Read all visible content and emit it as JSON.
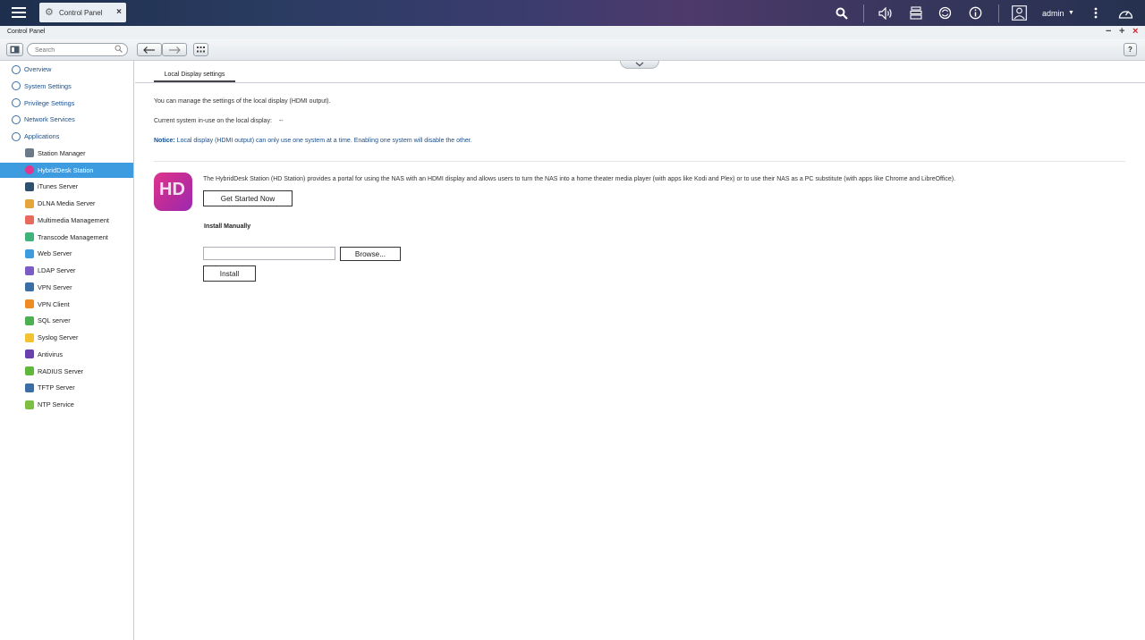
{
  "taskbar": {
    "app_tab_label": "Control Panel",
    "user_name": "admin",
    "icons": [
      "menu-icon",
      "search-icon",
      "volume-icon",
      "task-stack-icon",
      "sync-icon",
      "info-icon",
      "user-icon",
      "more-icon",
      "dashboard-icon"
    ]
  },
  "window": {
    "title": "Control Panel"
  },
  "toolbar": {
    "search_placeholder": "Search"
  },
  "sidebar": {
    "items": [
      {
        "label": "Overview",
        "level": "top",
        "icon": "grid-icon",
        "color": "#3a6ea5"
      },
      {
        "label": "System Settings",
        "level": "top",
        "icon": "gear-icon",
        "color": "#3a6ea5"
      },
      {
        "label": "Privilege Settings",
        "level": "top",
        "icon": "user-icon",
        "color": "#3a6ea5"
      },
      {
        "label": "Network Services",
        "level": "top",
        "icon": "globe-icon",
        "color": "#3a6ea5"
      },
      {
        "label": "Applications",
        "level": "top",
        "icon": "apps-icon",
        "color": "#3a6ea5"
      },
      {
        "label": "Station Manager",
        "level": "sub",
        "icon": "station-icon",
        "color": "#6b7a88"
      },
      {
        "label": "HybridDesk Station",
        "level": "sub",
        "icon": "hd-icon",
        "color": "#e0348d",
        "active": true
      },
      {
        "label": "iTunes Server",
        "level": "sub",
        "icon": "itunes-icon",
        "color": "#2f4f6f"
      },
      {
        "label": "DLNA Media Server",
        "level": "sub",
        "icon": "dlna-icon",
        "color": "#e7a43a"
      },
      {
        "label": "Multimedia Management",
        "level": "sub",
        "icon": "multimedia-icon",
        "color": "#e86a5c"
      },
      {
        "label": "Transcode Management",
        "level": "sub",
        "icon": "transcode-icon",
        "color": "#3eb37a"
      },
      {
        "label": "Web Server",
        "level": "sub",
        "icon": "web-icon",
        "color": "#3d9be0"
      },
      {
        "label": "LDAP Server",
        "level": "sub",
        "icon": "ldap-icon",
        "color": "#7b5cc4"
      },
      {
        "label": "VPN Server",
        "level": "sub",
        "icon": "vpn-server-icon",
        "color": "#3a6ea5"
      },
      {
        "label": "VPN Client",
        "level": "sub",
        "icon": "vpn-client-icon",
        "color": "#f08a24"
      },
      {
        "label": "SQL server",
        "level": "sub",
        "icon": "sql-icon",
        "color": "#4caf50"
      },
      {
        "label": "Syslog Server",
        "level": "sub",
        "icon": "syslog-icon",
        "color": "#f2c230"
      },
      {
        "label": "Antivirus",
        "level": "sub",
        "icon": "antivirus-icon",
        "color": "#6a3fb0"
      },
      {
        "label": "RADIUS Server",
        "level": "sub",
        "icon": "radius-icon",
        "color": "#5fb83b"
      },
      {
        "label": "TFTP Server",
        "level": "sub",
        "icon": "tftp-icon",
        "color": "#3a6ea5"
      },
      {
        "label": "NTP Service",
        "level": "sub",
        "icon": "ntp-icon",
        "color": "#7bc043"
      }
    ]
  },
  "content": {
    "tab_label": "Local Display settings",
    "intro": "You can manage the settings of the local display (HDMI output).",
    "current_system_label": "Current system in-use on the local display:",
    "current_system_value": "--",
    "notice_label": "Notice:",
    "notice_text": " Local display (HDMI output) can only use one system at a time. Enabling one system will disable the other.",
    "hd_logo_text": "HD",
    "hd_description": "The HybridDesk Station (HD Station) provides a portal for using the NAS with an HDMI display and allows users to turn the NAS into a home theater media player (with apps like Kodi and Plex) or to use their NAS as a PC substitute (with apps like Chrome and LibreOffice).",
    "get_started_label": "Get Started Now",
    "install_manually_label": "Install Manually",
    "file_value": "",
    "browse_label": "Browse...",
    "install_label": "Install"
  },
  "colors": {
    "active_item": "#3d9be0",
    "link_text": "#1a4f8a",
    "close_red": "#d0202a"
  }
}
